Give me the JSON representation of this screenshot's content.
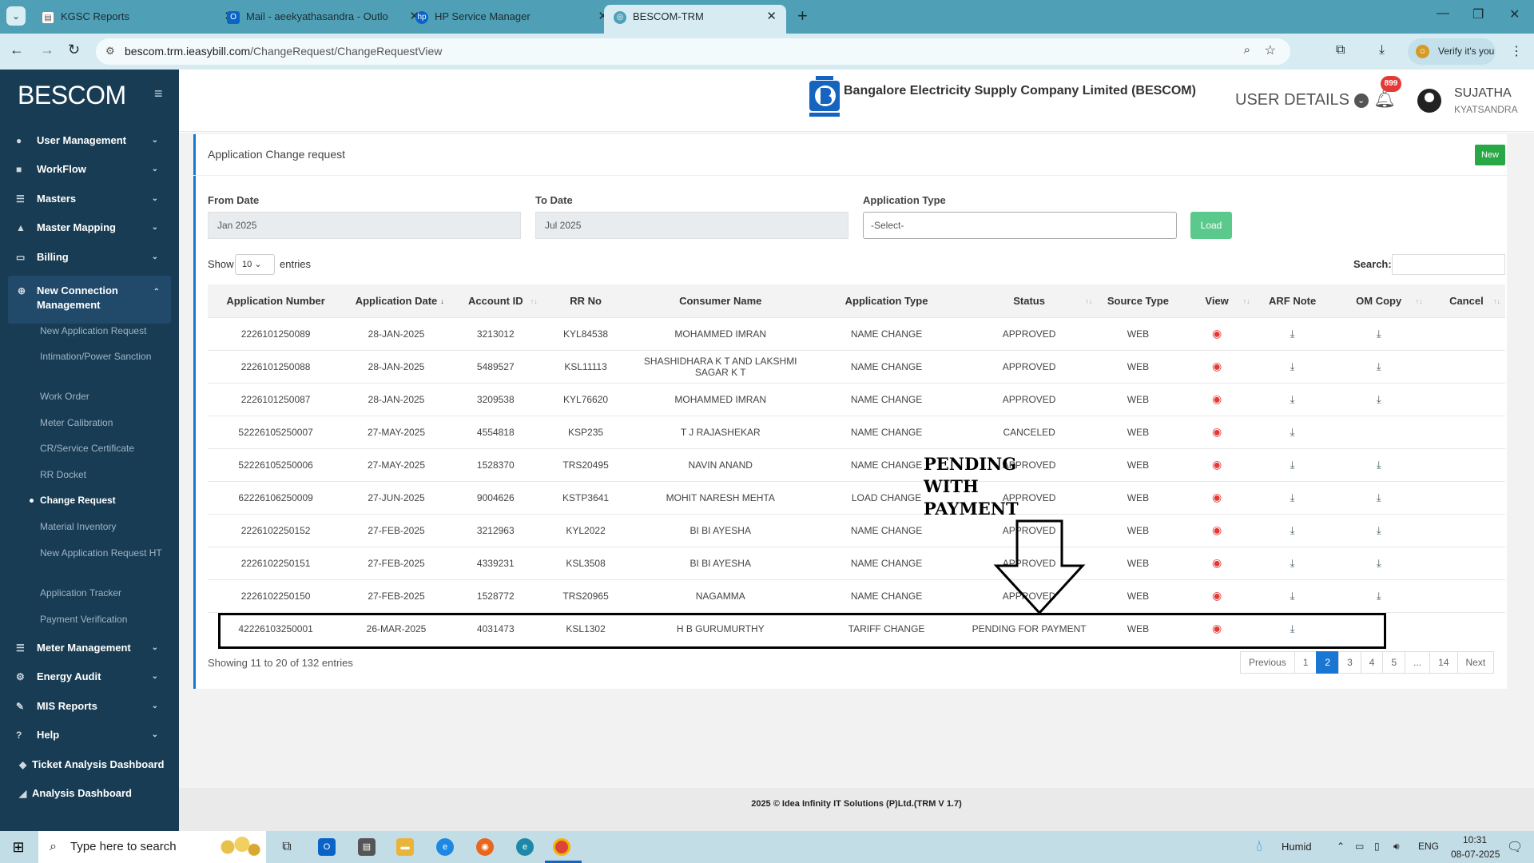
{
  "browser": {
    "tabs": [
      {
        "title": "KGSC Reports"
      },
      {
        "title": "Mail - aeekyathasandra - Outlo"
      },
      {
        "title": "HP Service Manager"
      },
      {
        "title": "BESCOM-TRM"
      }
    ],
    "url_host": "bescom.trm.ieasybill.com",
    "url_path": "/ChangeRequest/ChangeRequestView",
    "verify_label": "Verify it's you"
  },
  "sidebar": {
    "logo": "BESCOM",
    "items": [
      {
        "label": "User Management",
        "icon": "user-icon"
      },
      {
        "label": "WorkFlow",
        "icon": "workflow-icon"
      },
      {
        "label": "Masters",
        "icon": "list-icon"
      },
      {
        "label": "Master Mapping",
        "icon": "sitemap-icon"
      },
      {
        "label": "Billing",
        "icon": "monitor-icon"
      },
      {
        "label": "New Connection Management",
        "icon": "plus-circle-icon"
      },
      {
        "label": "Meter Management",
        "icon": "list-icon"
      },
      {
        "label": "Energy Audit",
        "icon": "gears-icon"
      },
      {
        "label": "MIS Reports",
        "icon": "wrench-icon"
      },
      {
        "label": "Help",
        "icon": "help-icon"
      },
      {
        "label": "Ticket Analysis Dashboard",
        "icon": "diamond-icon"
      },
      {
        "label": "Analysis Dashboard",
        "icon": "chart-icon"
      }
    ],
    "subitems": [
      "New Application Request",
      "Intimation/Power Sanction",
      "Work Order",
      "Meter Calibration",
      "CR/Service Certificate",
      "RR Docket",
      "Change Request",
      "Material Inventory",
      "New Application Request HT",
      "Application Tracker",
      "Payment Verification"
    ]
  },
  "header": {
    "company": "Bangalore Electricity Supply Company Limited (BESCOM)",
    "user_details": "USER DETAILS",
    "notifications": "899",
    "user_name": "SUJATHA",
    "user_location": "KYATSANDRA"
  },
  "page": {
    "title": "Application Change request",
    "new_button": "New",
    "from_date_label": "From Date",
    "from_date": "Jan 2025",
    "to_date_label": "To Date",
    "to_date": "Jul 2025",
    "app_type_label": "Application Type",
    "app_type": "-Select-",
    "load_button": "Load",
    "show_label": "Show",
    "show_value": "10",
    "entries_label": "entries",
    "search_label": "Search:",
    "showing": "Showing 11 to 20 of 132 entries"
  },
  "table": {
    "columns": [
      "Application Number",
      "Application Date",
      "Account ID",
      "RR No",
      "Consumer Name",
      "Application Type",
      "Status",
      "Source Type",
      "View",
      "ARF Note",
      "OM Copy",
      "Cancel"
    ],
    "rows": [
      {
        "app": "2226101250089",
        "date": "28-JAN-2025",
        "acc": "3213012",
        "rr": "KYL84538",
        "name": "MOHAMMED IMRAN",
        "type": "NAME CHANGE",
        "status": "APPROVED",
        "source": "WEB",
        "om": true
      },
      {
        "app": "2226101250088",
        "date": "28-JAN-2025",
        "acc": "5489527",
        "rr": "KSL11113",
        "name": "SHASHIDHARA K T AND LAKSHMI SAGAR K T",
        "type": "NAME CHANGE",
        "status": "APPROVED",
        "source": "WEB",
        "om": true
      },
      {
        "app": "2226101250087",
        "date": "28-JAN-2025",
        "acc": "3209538",
        "rr": "KYL76620",
        "name": "MOHAMMED IMRAN",
        "type": "NAME CHANGE",
        "status": "APPROVED",
        "source": "WEB",
        "om": true
      },
      {
        "app": "52226105250007",
        "date": "27-MAY-2025",
        "acc": "4554818",
        "rr": "KSP235",
        "name": "T J RAJASHEKAR",
        "type": "NAME CHANGE",
        "status": "CANCELED",
        "source": "WEB",
        "om": false
      },
      {
        "app": "52226105250006",
        "date": "27-MAY-2025",
        "acc": "1528370",
        "rr": "TRS20495",
        "name": "NAVIN ANAND",
        "type": "NAME CHANGE",
        "status": "APPROVED",
        "source": "WEB",
        "om": true
      },
      {
        "app": "62226106250009",
        "date": "27-JUN-2025",
        "acc": "9004626",
        "rr": "KSTP3641",
        "name": "MOHIT NARESH MEHTA",
        "type": "LOAD CHANGE",
        "status": "APPROVED",
        "source": "WEB",
        "om": true
      },
      {
        "app": "2226102250152",
        "date": "27-FEB-2025",
        "acc": "3212963",
        "rr": "KYL2022",
        "name": "BI BI AYESHA",
        "type": "NAME CHANGE",
        "status": "APPROVED",
        "source": "WEB",
        "om": true
      },
      {
        "app": "2226102250151",
        "date": "27-FEB-2025",
        "acc": "4339231",
        "rr": "KSL3508",
        "name": "BI BI AYESHA",
        "type": "NAME CHANGE",
        "status": "APPROVED",
        "source": "WEB",
        "om": true
      },
      {
        "app": "2226102250150",
        "date": "27-FEB-2025",
        "acc": "1528772",
        "rr": "TRS20965",
        "name": "NAGAMMA",
        "type": "NAME CHANGE",
        "status": "APPROVED",
        "source": "WEB",
        "om": true
      },
      {
        "app": "42226103250001",
        "date": "26-MAR-2025",
        "acc": "4031473",
        "rr": "KSL1302",
        "name": "H B GURUMURTHY",
        "type": "TARIFF CHANGE",
        "status": "PENDING FOR PAYMENT",
        "source": "WEB",
        "om": false
      }
    ]
  },
  "pagination": [
    "Previous",
    "1",
    "2",
    "3",
    "4",
    "5",
    "...",
    "14",
    "Next"
  ],
  "pagination_current": "2",
  "annotation": {
    "line1": "PENDING",
    "line2": "WITH",
    "line3": "PAYMENT"
  },
  "footer": "2025 © Idea Infinity IT Solutions (P)Ltd.(TRM V 1.7)",
  "taskbar": {
    "search_placeholder": "Type here to search",
    "weather": "Humid",
    "lang": "ENG",
    "time": "10:31",
    "date": "08-07-2025"
  }
}
